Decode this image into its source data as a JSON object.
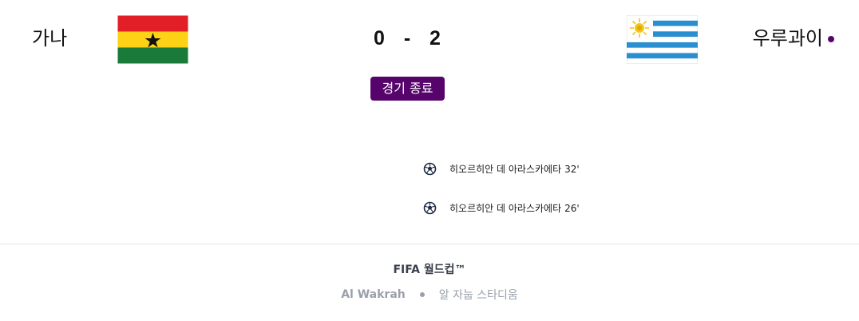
{
  "match": {
    "home": {
      "name": "가나",
      "flag": "ghana-flag"
    },
    "away": {
      "name": "우루과이",
      "flag": "uruguay-flag"
    },
    "score": {
      "home": "0",
      "separator": "-",
      "away": "2"
    },
    "status": "경기 종료",
    "goals": [
      {
        "player": "히오르히안 데 아라스카에타",
        "minute": "32'",
        "icon": "soccer-ball-icon"
      },
      {
        "player": "히오르히안 데 아라스카에타",
        "minute": "26'",
        "icon": "soccer-ball-icon"
      }
    ]
  },
  "footer": {
    "competition": "FIFA 월드컵™",
    "city": "Al Wakrah",
    "stadium": "알 자눕 스타디움"
  },
  "colors": {
    "accent": "#56046c",
    "ghana_red": "#e21e26",
    "ghana_yellow": "#fcd116",
    "ghana_green": "#1a7a3a",
    "uruguay_blue": "#2a8fd0",
    "uruguay_sun": "#f5c518"
  }
}
